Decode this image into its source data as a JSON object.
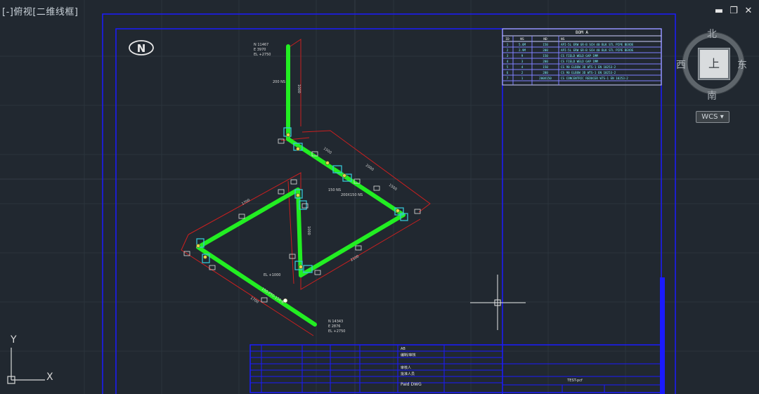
{
  "viewport": {
    "label": "[-]俯视[二维线框]",
    "controls": {
      "minimize": "▬",
      "restore": "❐",
      "close": "✕"
    }
  },
  "viewcube": {
    "north": "北",
    "south": "南",
    "east": "东",
    "west": "西",
    "face": "上",
    "wcs_label": "WCS",
    "wcs_arrow": "▾"
  },
  "ucs": {
    "x_label": "X",
    "y_label": "Y"
  },
  "drawing": {
    "north_symbol": "N",
    "pipe_color": "#22ee22",
    "frame_color": "#1a1aff",
    "dimension_color": "#cc1f1f",
    "bom": {
      "title": "BOM A",
      "headers": [
        "ID",
        "NS",
        "ND",
        "NS"
      ],
      "rows": [
        [
          "1",
          "5.6M",
          "150",
          "API-5L ERW GR-B SCH 40 BLK STL PIPE BEVDE"
        ],
        [
          "2",
          "2.9M",
          "200",
          "API-5L ERW GR-B SCH 40 BLK STL PIPE BEVDE"
        ],
        [
          "3",
          "9",
          "150",
          "CS FIELD WELD GAP 1MM"
        ],
        [
          "4",
          "3",
          "200",
          "CS FIELD WELD GAP 1MM"
        ],
        [
          "5",
          "4",
          "150",
          "CS 90 ELBOW 3D WTS-1 EN 10253-2"
        ],
        [
          "6",
          "2",
          "200",
          "CS 90 ELBOW 3D WTS-1 EN 10253-2"
        ],
        [
          "7",
          "1",
          "200X150",
          "CS CONCENTRIC REDUCER WTS-1 EN 10253-2"
        ]
      ]
    },
    "annotations": {
      "top_coords": [
        "N 11467",
        "E 3970",
        "EL +2750"
      ],
      "bottom_coords": [
        "N 14343",
        "E 2876",
        "EL +2750"
      ],
      "el_mid": "EL +1000",
      "reducer_label": "150 NS",
      "reducer_label2": "200X150 NS",
      "pipe_tag": "150-PT0-150-B",
      "size_200": "200 NS",
      "dims": [
        "1000",
        "1700",
        "1500",
        "2000",
        "1500",
        "2100",
        "1700",
        "1000"
      ]
    },
    "title_block": {
      "labels": [
        "AB",
        "编制/审核",
        "审核人",
        "批准人员",
        "PaId DWG"
      ],
      "file_name": "TEST-pcf"
    }
  }
}
